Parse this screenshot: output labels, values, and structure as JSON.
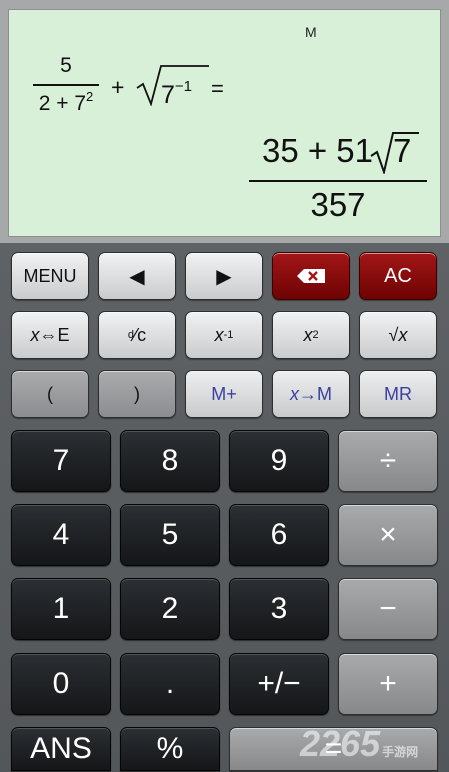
{
  "display": {
    "memory_indicator": "M",
    "expression": {
      "frac_num": "5",
      "frac_den_base": "2 + 7",
      "frac_den_exp": "2",
      "plus": "+",
      "radicand_base": "7",
      "radicand_exp": "−1",
      "equals": "="
    },
    "result": {
      "numerator_text": "35 + 51",
      "numerator_radicand": "7",
      "denominator": "357"
    }
  },
  "keys": {
    "menu": "MENU",
    "left": "◀",
    "right": "▶",
    "backspace": "⌫",
    "ac": "AC",
    "x_e_x": "x",
    "x_e_rest": "⇔E",
    "dc_d": "d",
    "dc_slash": "⁄",
    "dc_c": "c",
    "inv_x": "x",
    "inv_exp": "-1",
    "sq_x": "x",
    "sq_exp": "2",
    "sqrt_sym": "√",
    "sqrt_x": "x",
    "lparen": "(",
    "rparen": ")",
    "m_plus": "M+",
    "x_to_m_x": "x",
    "x_to_m_rest": "→M",
    "mr": "MR",
    "d7": "7",
    "d8": "8",
    "d9": "9",
    "div": "÷",
    "d4": "4",
    "d5": "5",
    "d6": "6",
    "mul": "×",
    "d1": "1",
    "d2": "2",
    "d3": "3",
    "sub": "−",
    "d0": "0",
    "dot": ".",
    "neg": "+/−",
    "add": "+",
    "ans": "ANS",
    "pct": "%",
    "eq": "="
  },
  "watermark": {
    "text": "2265",
    "sub": "手游网"
  },
  "colors": {
    "lcd": "#d9f0d8",
    "red_key": "#a31617",
    "mem_text": "#3c3f9e",
    "dark_key": "#1f2226"
  }
}
